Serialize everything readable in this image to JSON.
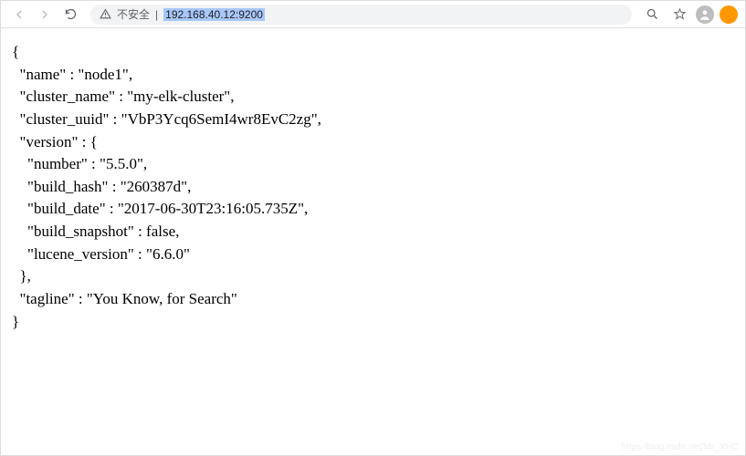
{
  "address_bar": {
    "insecure_label": "不安全",
    "separator": "|",
    "url": "192.168.40.12:9200"
  },
  "response": {
    "name": "node1",
    "cluster_name": "my-elk-cluster",
    "cluster_uuid": "VbP3Ycq6SemI4wr8EvC2zg",
    "version": {
      "number": "5.5.0",
      "build_hash": "260387d",
      "build_date": "2017-06-30T23:16:05.735Z",
      "build_snapshot": false,
      "lucene_version": "6.6.0"
    },
    "tagline": "You Know, for Search"
  },
  "watermark": "https-fblog.csdn.net/Mr_XHC"
}
